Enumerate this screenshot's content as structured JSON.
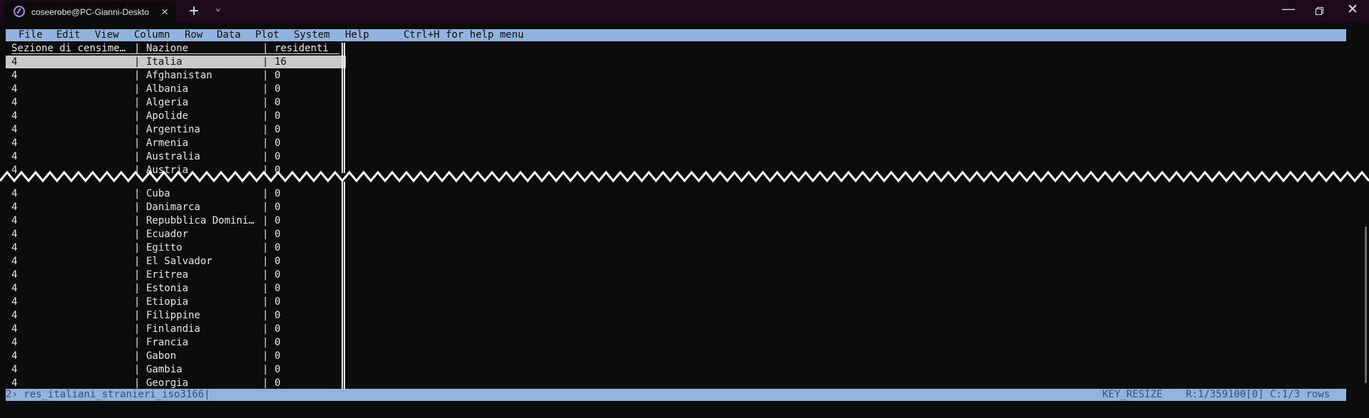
{
  "window": {
    "tab_title": "coseerobe@PC-Gianni-Deskto",
    "tab_close": "×",
    "new_tab": "+",
    "dropdown": "⌄",
    "minimize": "—",
    "close": "✕"
  },
  "menu": {
    "items": [
      "File",
      "Edit",
      "View",
      "Column",
      "Row",
      "Data",
      "Plot",
      "System",
      "Help"
    ],
    "help_hint": "Ctrl+H for help menu"
  },
  "table": {
    "headers": [
      "Sezione di censime…",
      "Nazione",
      "residenti"
    ],
    "rows": [
      [
        "4",
        "Italia",
        "16"
      ],
      [
        "4",
        "Afghanistan",
        "0"
      ],
      [
        "4",
        "Albania",
        "0"
      ],
      [
        "4",
        "Algeria",
        "0"
      ],
      [
        "4",
        "Apolide",
        "0"
      ],
      [
        "4",
        "Argentina",
        "0"
      ],
      [
        "4",
        "Armenia",
        "0"
      ],
      [
        "4",
        "Australia",
        "0"
      ],
      [
        "4",
        "Austria",
        "0"
      ],
      [
        "4",
        "Cuba",
        "0"
      ],
      [
        "4",
        "Danimarca",
        "0"
      ],
      [
        "4",
        "Repubblica Domini…",
        "0"
      ],
      [
        "4",
        "Ecuador",
        "0"
      ],
      [
        "4",
        "Egitto",
        "0"
      ],
      [
        "4",
        "El Salvador",
        "0"
      ],
      [
        "4",
        "Eritrea",
        "0"
      ],
      [
        "4",
        "Estonia",
        "0"
      ],
      [
        "4",
        "Etiopia",
        "0"
      ],
      [
        "4",
        "Filippine",
        "0"
      ],
      [
        "4",
        "Finlandia",
        "0"
      ],
      [
        "4",
        "Francia",
        "0"
      ],
      [
        "4",
        "Gabon",
        "0"
      ],
      [
        "4",
        "Gambia",
        "0"
      ],
      [
        "4",
        "Georgia",
        "0"
      ]
    ]
  },
  "status": {
    "prompt": "2› res_italiani_stranieri_iso3166|",
    "key": "KEY_RESIZE",
    "position": "R:1/359100[0] C:1/3 rows"
  },
  "colors": {
    "menubar": "#91b3dd",
    "terminal_bg": "#0c0c0c",
    "selected_row": "#c9c9c9"
  }
}
